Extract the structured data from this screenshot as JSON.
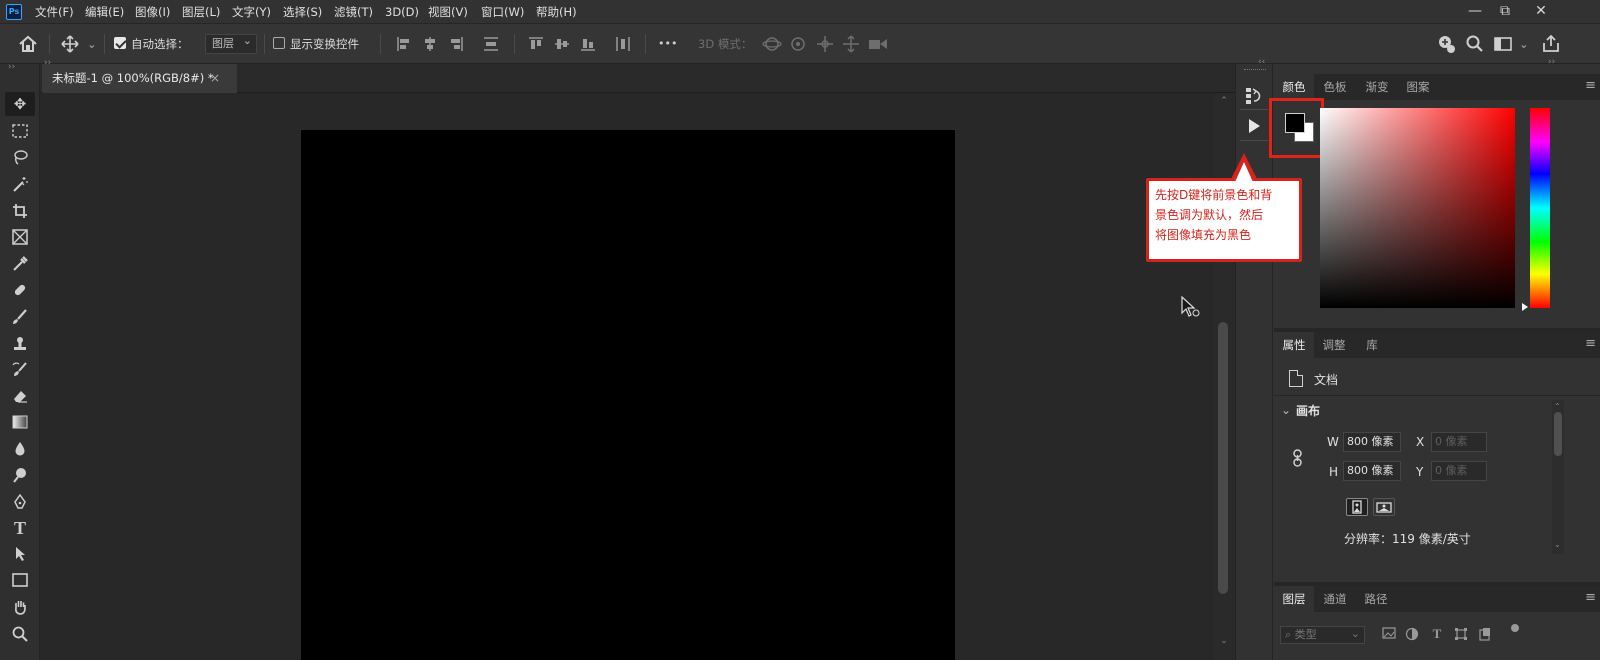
{
  "app": {
    "logo": "Ps",
    "menus": [
      "文件(F)",
      "编辑(E)",
      "图像(I)",
      "图层(L)",
      "文字(Y)",
      "选择(S)",
      "滤镜(T)",
      "3D(D)",
      "视图(V)",
      "窗口(W)",
      "帮助(H)"
    ],
    "window_controls": {
      "minimize": "—",
      "restore": "⧉",
      "close": "✕"
    }
  },
  "options_bar": {
    "auto_select_label": "自动选择：",
    "auto_select_checked": true,
    "layer_target": "图层",
    "show_transform_label": "显示变换控件",
    "show_transform_checked": false,
    "more": "•••",
    "mode_3d_label": "3D 模式："
  },
  "document_tab": {
    "title": "未标题-1 @ 100%(RGB/8#) *",
    "close": "×"
  },
  "color_panel": {
    "tabs": [
      "颜色",
      "色板",
      "渐变",
      "图案"
    ],
    "active_tab": 0,
    "foreground": "#000000",
    "background": "#ffffff"
  },
  "callout": {
    "line1": "先按D键将前景色和背",
    "line2": "景色调为默认，然后",
    "line3": "将图像填充为黑色",
    "color": "#d6231c"
  },
  "properties_panel": {
    "tabs": [
      "属性",
      "调整",
      "库"
    ],
    "active_tab": 0,
    "doc_label": "文档",
    "section_title": "画布",
    "w_label": "W",
    "w_value": "800 像素",
    "h_label": "H",
    "h_value": "800 像素",
    "x_label": "X",
    "x_placeholder": "0 像素",
    "y_label": "Y",
    "y_placeholder": "0 像素",
    "resolution": "分辨率：119 像素/英寸"
  },
  "layers_panel": {
    "tabs": [
      "图层",
      "通道",
      "路径"
    ],
    "active_tab": 0,
    "filter_placeholder": "类型"
  }
}
